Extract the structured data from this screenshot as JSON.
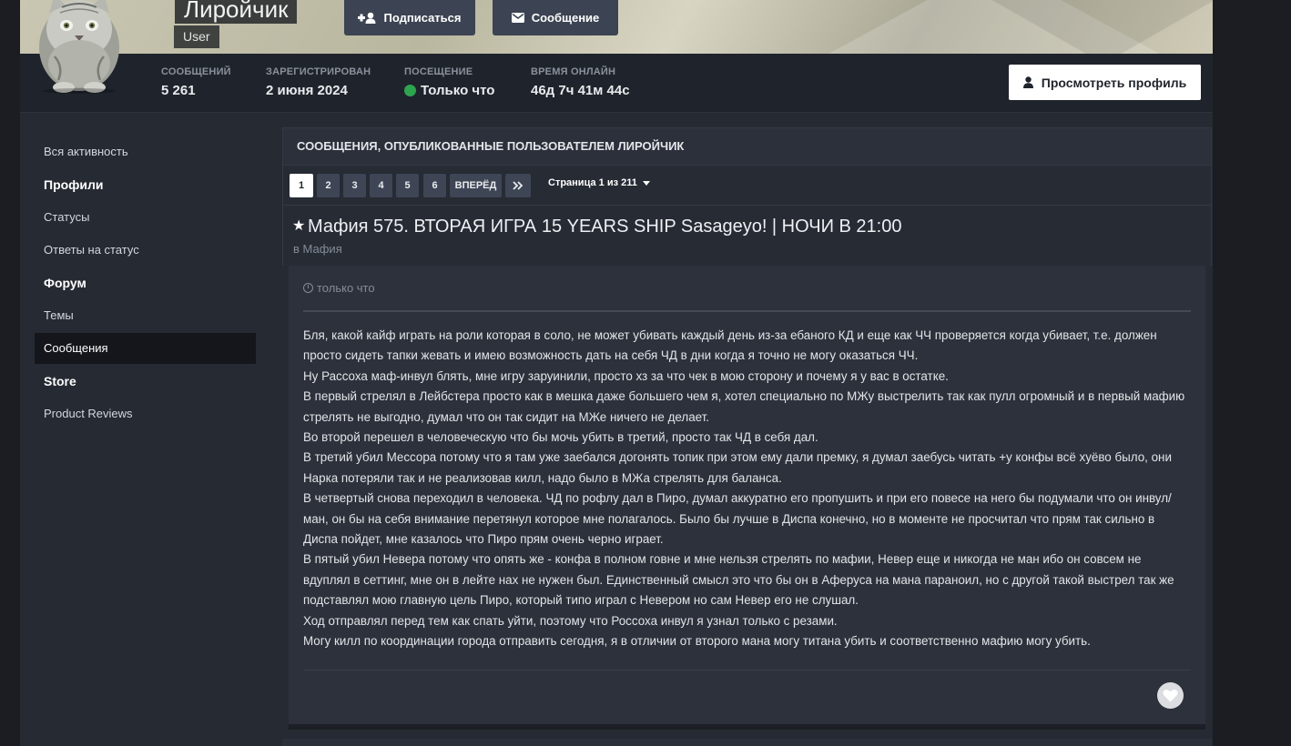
{
  "profile": {
    "username": "Лиройчик",
    "role": "User",
    "follow_label": "Подписаться",
    "message_label": "Сообщение",
    "view_profile_label": "Просмотреть профиль"
  },
  "stats": [
    {
      "label": "Сообщений",
      "value": "5 261"
    },
    {
      "label": "Зарегистрирован",
      "value": "2 июня 2024"
    },
    {
      "label": "Посещение",
      "value": "Только что",
      "online": true
    },
    {
      "label": "Время онлайн",
      "value": "46д 7ч 41м 44с"
    }
  ],
  "sidebar": {
    "items": [
      {
        "type": "link",
        "label": "Вся активность"
      },
      {
        "type": "head",
        "label": "Профили"
      },
      {
        "type": "link",
        "label": "Статусы"
      },
      {
        "type": "link",
        "label": "Ответы на статус"
      },
      {
        "type": "head",
        "label": "Форум"
      },
      {
        "type": "link",
        "label": "Темы"
      },
      {
        "type": "link",
        "label": "Сообщения",
        "active": true
      },
      {
        "type": "head",
        "label": "Store"
      },
      {
        "type": "link",
        "label": "Product Reviews"
      }
    ]
  },
  "main": {
    "section_title": "Сообщения, опубликованные пользователем Лиройчик",
    "pagination": {
      "pages": [
        "1",
        "2",
        "3",
        "4",
        "5",
        "6"
      ],
      "current": "1",
      "next_label": "ВПЕРЁД",
      "last_label": "»",
      "page_info": "Страница 1 из 211"
    },
    "topic": {
      "title": "Мафия 575. ВТОРАЯ ИГРА 15 YEARS SHIP Sasageyo! | НОЧИ В 21:00",
      "forum_prefix": "в",
      "forum_name": "Мафия"
    },
    "post": {
      "time": "только что",
      "paragraphs": [
        "Бля, какой кайф играть на роли которая в соло, не может убивать каждый день из-за ебаного КД и еще как ЧЧ проверяется когда убивает, т.е. должен просто сидеть тапки жевать и имею возможность дать на себя ЧД в дни когда я точно не могу оказаться ЧЧ.",
        "Ну Рассоха маф-инвул блять, мне игру заруинили, просто хз за что чек в мою сторону и почему я у вас в остатке.",
        "В первый стрелял в Лейбстера просто как в мешка даже большего чем я, хотел специально по МЖу выстрелить так как пулл огромный и в первый мафию стрелять не выгодно, думал что он так сидит на МЖе ничего не делает.",
        "Во второй перешел в человеческую что бы мочь убить в третий, просто так ЧД в себя дал.",
        "В третий убил Мессора потому что я там уже заебался догонять топик при этом ему дали премку, я думал заебусь читать +у конфы всё хуёво было, они Нарка потеряли так и не реализовав килл, надо было в МЖа стрелять для баланса.",
        "В четвертый снова переходил в человека. ЧД по рофлу дал в Пиро, думал аккуратно его пропушить и при его повесе на него бы подумали что он инвул/ман, он бы на себя внимание перетянул которое мне полагалось. Было бы лучше в Диспа конечно, но в моменте не просчитал что прям так сильно в Диспа пойдет, мне казалось что Пиро прям очень черно играет.",
        "В пятый убил Невера потому что опять же - конфа в полном говне и мне нельзя стрелять по мафии, Невер еще и никогда не ман ибо он совсем не вдуплял в сеттинг, мне он в лейте нах не нужен был. Единственный смысл это что бы он в Аферуса на мана параноил, но с другой такой выстрел так же подставлял мою главную цель Пиро, который типо играл с Невером но сам Невер его не слушал.",
        "Ход отправлял перед тем как спать уйти, поэтому что Россоха инвул я узнал только с резами.",
        "Могу килл по координации города отправить сегодня, я в отличии от второго мана могу титана убить и соответственно мафию могу убить."
      ]
    }
  },
  "colors": {
    "online": "#2ea44f",
    "button_dark": "#3c4352",
    "page_bg": "#252a33"
  },
  "icons": [
    "user-plus-icon",
    "envelope-icon",
    "user-icon",
    "star-icon",
    "clock-icon",
    "heart-icon",
    "double-chevron-right-icon",
    "caret-down-icon"
  ]
}
